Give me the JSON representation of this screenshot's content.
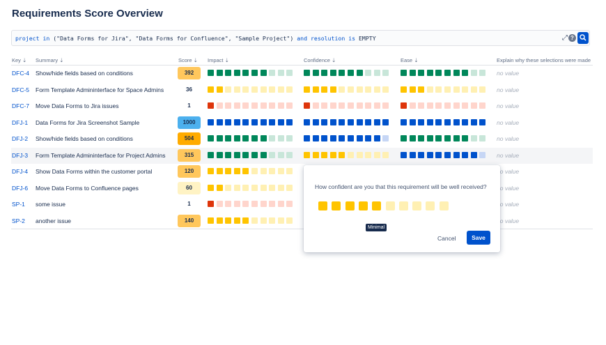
{
  "page": {
    "title": "Requirements Score Overview"
  },
  "jql": {
    "tokens": [
      {
        "t": "project",
        "k": "kw"
      },
      {
        "t": " "
      },
      {
        "t": "in",
        "k": "kw"
      },
      {
        "t": " (\"Data Forms for Jira\", \"Data Forms for Confluence\", \"Sample Project\") "
      },
      {
        "t": "and",
        "k": "kw"
      },
      {
        "t": " "
      },
      {
        "t": "resolution",
        "k": "kw"
      },
      {
        "t": " "
      },
      {
        "t": "is",
        "k": "kw"
      },
      {
        "t": " EMPTY"
      }
    ],
    "help_glyph": "?",
    "expand_glyph": "⤢"
  },
  "columns": {
    "key": "Key",
    "summary": "Summary",
    "score": "Score",
    "impact": "Impact",
    "confidence": "Confidence",
    "ease": "Ease",
    "explain": "Explain why these selections were made"
  },
  "colors": {
    "green": [
      "#00875a",
      "#c8e6d9"
    ],
    "yellow": [
      "#ffc400",
      "#fff0b3"
    ],
    "red": [
      "#de350b",
      "#ffd5cc"
    ],
    "blue": [
      "#0052cc",
      "#c6d6f5"
    ],
    "score_bg": {
      "orange": "#ffab00",
      "lightorange": "#ffc75c",
      "cream": "#fff3c4",
      "blue": "#4cb0ee",
      "none": "transparent"
    }
  },
  "rows": [
    {
      "key": "DFC-4",
      "summary": "Show/hide fields based on conditions",
      "score": "392",
      "score_color": "lightorange",
      "impact": [
        "green",
        7
      ],
      "confidence": [
        "green",
        7
      ],
      "ease": [
        "green",
        8
      ],
      "explain": "no value"
    },
    {
      "key": "DFC-5",
      "summary": "Form Template Admininterface for Space Admins",
      "score": "36",
      "score_color": "none",
      "impact": [
        "yellow",
        2
      ],
      "confidence": [
        "yellow",
        4
      ],
      "ease": [
        "yellow",
        3
      ],
      "explain": "no value"
    },
    {
      "key": "DFC-7",
      "summary": "Move Data Forms to Jira issues",
      "score": "1",
      "score_color": "none",
      "impact": [
        "red",
        1
      ],
      "confidence": [
        "red",
        1
      ],
      "ease": [
        "red",
        1
      ],
      "explain": "no value"
    },
    {
      "key": "DFJ-1",
      "summary": "Data Forms for Jira Screenshot Sample",
      "score": "1000",
      "score_color": "blue",
      "impact": [
        "blue",
        10
      ],
      "confidence": [
        "blue",
        10
      ],
      "ease": [
        "blue",
        10
      ],
      "explain": "no value"
    },
    {
      "key": "DFJ-2",
      "summary": "Show/hide fields based on conditions",
      "score": "504",
      "score_color": "orange",
      "impact": [
        "green",
        7
      ],
      "confidence": [
        "blue",
        9
      ],
      "ease": [
        "green",
        8
      ],
      "explain": "no value"
    },
    {
      "key": "DFJ-3",
      "summary": "Form Template Admininterface for Project Admins",
      "score": "315",
      "score_color": "lightorange",
      "impact": [
        "green",
        7
      ],
      "confidence": [
        "yellow",
        5
      ],
      "ease": [
        "blue",
        9
      ],
      "explain": "no value",
      "highlight": true
    },
    {
      "key": "DFJ-4",
      "summary": "Show Data Forms within the customer portal",
      "score": "120",
      "score_color": "lightorange",
      "impact": [
        "yellow",
        5
      ],
      "confidence": [
        "yellow",
        4
      ],
      "ease": [
        "yellow",
        4
      ],
      "explain": "no value"
    },
    {
      "key": "DFJ-6",
      "summary": "Move Data Forms to Confluence pages",
      "score": "60",
      "score_color": "cream",
      "impact": [
        "yellow",
        2
      ],
      "confidence": [
        "yellow",
        3
      ],
      "ease": [
        "yellow",
        3
      ],
      "explain": "no value"
    },
    {
      "key": "SP-1",
      "summary": "some issue",
      "score": "1",
      "score_color": "none",
      "impact": [
        "red",
        1
      ],
      "confidence": [
        "red",
        1
      ],
      "ease": [
        "red",
        1
      ],
      "explain": "no value"
    },
    {
      "key": "SP-2",
      "summary": "another issue",
      "score": "140",
      "score_color": "lightorange",
      "impact": [
        "yellow",
        5
      ],
      "confidence": [
        "yellow",
        4
      ],
      "ease": [
        "yellow",
        4
      ],
      "explain": "no value"
    }
  ],
  "popup": {
    "question": "How confident are you that this requirement will be well received?",
    "selected": 5,
    "total": 10,
    "color": "yellow",
    "tooltip": "Minimal",
    "cancel_label": "Cancel",
    "save_label": "Save"
  }
}
